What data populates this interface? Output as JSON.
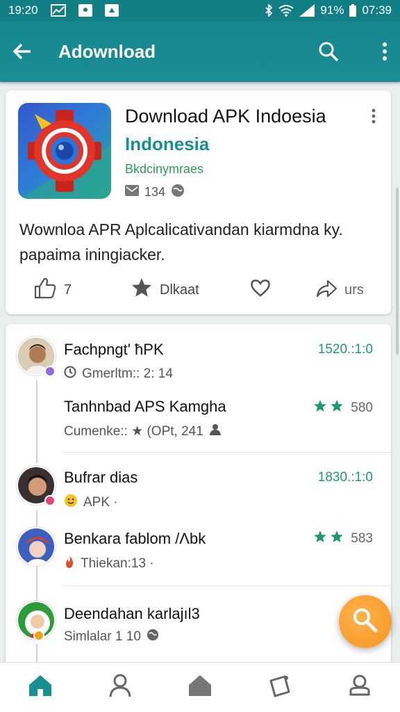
{
  "status_bar": {
    "time_left": "19:20",
    "battery": "91%",
    "time_right": "07:39"
  },
  "app_bar": {
    "title": "Adownload"
  },
  "app_card": {
    "title": "Download APK Indoesia",
    "subtitle": "Indonesia",
    "developer": "Bkdcinymraes",
    "meta_count": "134",
    "description": "Wownloa APR Aplcalicativandan kiarmdna ky. papaima iningiacker.",
    "actions": {
      "like_count": "7",
      "rate_label": "Dlkaat",
      "share_label": "urs"
    }
  },
  "list": [
    {
      "title": "Fachpngt' ħPK",
      "sub": "Gmerltm:: 2: 14",
      "right": "1520.:1:0"
    },
    {
      "title": "Tanhnbad APS Kamgha",
      "sub": "Cumenke:: ★ (OPt, 241",
      "right": "580"
    },
    {
      "title": "Bufrar dias",
      "sub": "APK ·",
      "right": "1830.:1:0"
    },
    {
      "title": "Benkara fablom /Λbk",
      "sub": "Thiekan:13 ·",
      "right": "583"
    },
    {
      "title": "Deendahan karlajıl3",
      "sub": "Simlalar 1 10",
      "right": ""
    }
  ],
  "colors": {
    "primary": "#16878e",
    "accent_green": "#1f9a6a",
    "fab": "#f7931e"
  },
  "icons": [
    "back-arrow-icon",
    "search-icon",
    "more-vert-icon",
    "thumbs-up-icon",
    "star-icon",
    "heart-icon",
    "share-icon",
    "home-icon",
    "person-icon",
    "store-icon",
    "notes-icon",
    "account-icon"
  ]
}
